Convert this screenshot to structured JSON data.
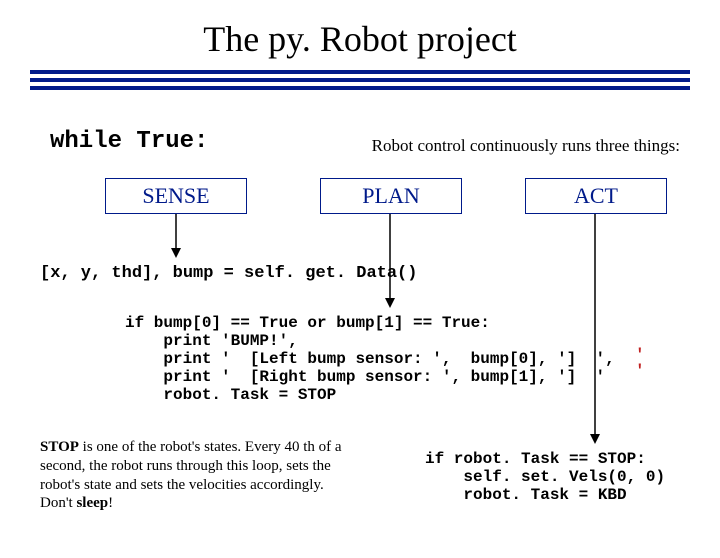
{
  "title": "The py. Robot project",
  "while": "while True:",
  "subtitle": "Robot control continuously runs three things:",
  "boxes": {
    "sense": "SENSE",
    "plan": "PLAN",
    "act": "ACT"
  },
  "code1": "[x, y, thd], bump = self. get. Data()",
  "code2": "if bump[0] == True or bump[1] == True:\n    print 'BUMP!',\n    print '  [Left bump sensor: ',  bump[0], ']  ',\n    print '  [Right bump sensor: ', bump[1], ']  '\n    robot. Task = STOP",
  "code2_q": {
    "a": "'",
    "b": "'"
  },
  "footnote": {
    "pre": "STOP",
    "body": " is one of the robot's states. Every 40 th of a second, the robot runs through this loop, sets the robot's state and sets the velocities accordingly. Don't ",
    "sleep": "sleep",
    "end": "!"
  },
  "code3": "if robot. Task == STOP:\n    self. set. Vels(0, 0)\n    robot. Task = KBD"
}
